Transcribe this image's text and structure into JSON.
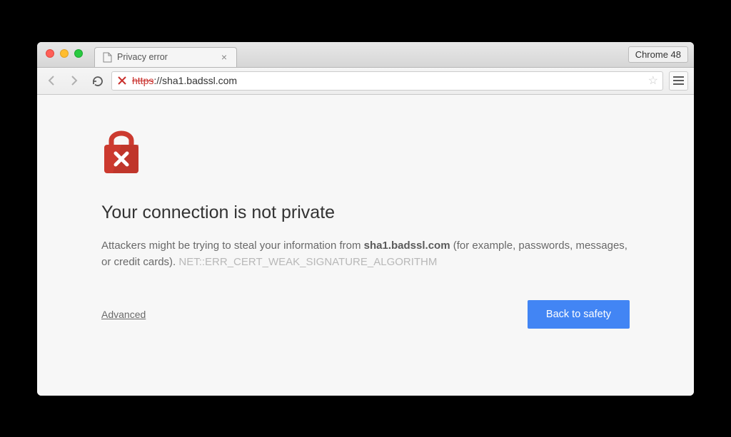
{
  "window": {
    "version_label": "Chrome 48"
  },
  "tab": {
    "title": "Privacy error"
  },
  "omnibox": {
    "protocol": "https",
    "separator": "://",
    "host": "sha1.badssl.com"
  },
  "page": {
    "heading": "Your connection is not private",
    "description_prefix": "Attackers might be trying to steal your information from ",
    "description_host": "sha1.badssl.com",
    "description_suffix": " (for example, passwords, messages, or credit cards). ",
    "error_code": "NET::ERR_CERT_WEAK_SIGNATURE_ALGORITHM",
    "advanced_label": "Advanced",
    "safety_button": "Back to safety"
  },
  "colors": {
    "danger": "#c9302c",
    "primary_button": "#4285f4"
  }
}
